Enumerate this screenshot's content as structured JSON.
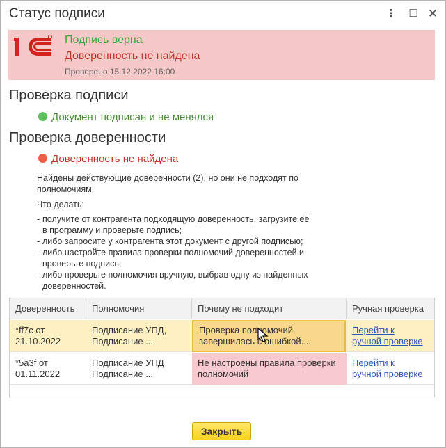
{
  "window": {
    "title": "Статус подписи",
    "more_icon": "vertical-dots",
    "maximize_icon": "square",
    "close_icon": "x"
  },
  "banner": {
    "status_ok": "Подпись верна",
    "status_err": "Доверенность не найдена",
    "checked": "Проверено 15.12.2022 16:00",
    "logo": "1C logo",
    "colors": {
      "background": "#f6c8c8",
      "ok": "#3aa33a",
      "error": "#c3332b"
    }
  },
  "signature_check": {
    "heading": "Проверка подписи",
    "status": "Документ подписан и не менялся",
    "status_color": "#5cc05c"
  },
  "poa_check": {
    "heading": "Проверка доверенности",
    "status": "Доверенность не найдена",
    "status_color": "#ee5e46",
    "found_line1": "Найдены действующие доверенности (2), но они не подходят по",
    "found_line2": "полномочиям.",
    "what_to_do": "Что делать:",
    "advice": [
      [
        "получите от контрагента подходящую доверенность, загрузите её",
        "в программу и проверьте подпись;"
      ],
      [
        "либо запросите у контрагента этот документ с другой подписью;"
      ],
      [
        "либо настройте правила проверки полномочий доверенностей и",
        "проверьте подпись;"
      ],
      [
        "либо проверьте полномочия вручную, выбрав одну из найденных",
        "доверенностей."
      ]
    ]
  },
  "table": {
    "columns": [
      "Доверенность",
      "Полномочия",
      "Почему не подходит",
      "Ручная проверка"
    ],
    "rows": [
      {
        "poa": [
          "*ff7c от",
          "21.10.2022"
        ],
        "powers": [
          "Подписание УПД,",
          "Подписание ..."
        ],
        "reason": [
          "Проверка полномочий",
          "завершилась с ошибкой...."
        ],
        "manual": [
          "Перейти к",
          "ручной проверке"
        ]
      },
      {
        "poa": [
          "*5a3f от",
          "01.11.2022"
        ],
        "powers": [
          "Подписание УПД",
          "Подписание ..."
        ],
        "reason": [
          "Не настроены правила проверки",
          "полномочий"
        ],
        "manual": [
          "Перейти к",
          "ручной проверке"
        ]
      }
    ]
  },
  "footer": {
    "close_label": "Закрыть"
  }
}
